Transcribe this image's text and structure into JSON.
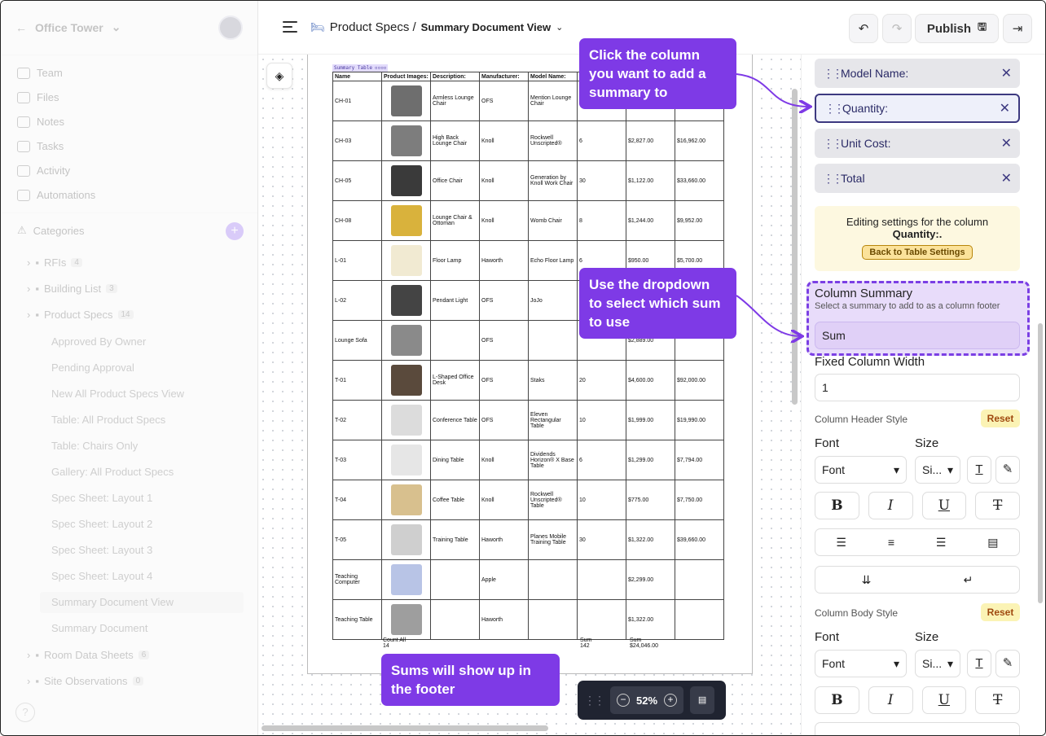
{
  "sidebar": {
    "workspace": "Office Tower",
    "nav": [
      {
        "label": "Team",
        "icon": "people-icon"
      },
      {
        "label": "Files",
        "icon": "file-icon"
      },
      {
        "label": "Notes",
        "icon": "note-icon"
      },
      {
        "label": "Tasks",
        "icon": "task-icon"
      },
      {
        "label": "Activity",
        "icon": "activity-icon"
      },
      {
        "label": "Automations",
        "icon": "bolt-icon"
      }
    ],
    "categories_label": "Categories",
    "tree": [
      {
        "label": "RFIs",
        "count": "4"
      },
      {
        "label": "Building List",
        "count": "3"
      },
      {
        "label": "Product Specs",
        "count": "14"
      }
    ],
    "views": [
      "Approved By Owner",
      "Pending Approval",
      "New All Product Specs View",
      "Table: All Product Specs",
      "Table: Chairs Only",
      "Gallery: All Product Specs",
      "Spec Sheet: Layout 1",
      "Spec Sheet: Layout 2",
      "Spec Sheet: Layout 3",
      "Spec Sheet: Layout 4",
      "Summary Document View",
      "Summary Document"
    ],
    "tree2": [
      {
        "label": "Room Data Sheets",
        "count": "6"
      },
      {
        "label": "Site Observations",
        "count": "0"
      }
    ],
    "help": "?"
  },
  "topbar": {
    "crumb1": "Product Specs /",
    "crumb2": "Summary Document View",
    "publish": "Publish"
  },
  "document": {
    "tag": "Summary Table",
    "headers": [
      "Name",
      "Product Images:",
      "Description:",
      "Manufacturer:",
      "Model Name:",
      "",
      "",
      ""
    ],
    "rows": [
      {
        "name": "CH-01",
        "desc": "Armless Lounge Chair",
        "mfr": "OFS",
        "model": "Mention Lounge Chair",
        "qty": "",
        "cost": "",
        "total": "",
        "color": "#6e6e6e"
      },
      {
        "name": "CH-03",
        "desc": "High Back Lounge Chair",
        "mfr": "Knoll",
        "model": "Rockwell Unscripted®",
        "qty": "6",
        "cost": "$2,827.00",
        "total": "$16,962.00",
        "color": "#7d7d7d"
      },
      {
        "name": "CH-05",
        "desc": "Office Chair",
        "mfr": "Knoll",
        "model": "Generation by Knoll Work Chair",
        "qty": "30",
        "cost": "$1,122.00",
        "total": "$33,660.00",
        "color": "#3a3a3a"
      },
      {
        "name": "CH-08",
        "desc": "Lounge Chair & Ottoman",
        "mfr": "Knoll",
        "model": "Womb Chair",
        "qty": "8",
        "cost": "$1,244.00",
        "total": "$9,952.00",
        "color": "#d9b23c"
      },
      {
        "name": "L-01",
        "desc": "Floor Lamp",
        "mfr": "Haworth",
        "model": "Echo Floor Lamp",
        "qty": "6",
        "cost": "$950.00",
        "total": "$5,700.00",
        "color": "#f1ead2"
      },
      {
        "name": "L-02",
        "desc": "Pendant Light",
        "mfr": "OFS",
        "model": "JoJo",
        "qty": "",
        "cost": "",
        "total": "",
        "color": "#444444"
      },
      {
        "name": "Lounge Sofa",
        "desc": "",
        "mfr": "OFS",
        "model": "",
        "qty": "",
        "cost": "$2,889.00",
        "total": "",
        "color": "#8a8a8a"
      },
      {
        "name": "T-01",
        "desc": "L-Shaped Office Desk",
        "mfr": "OFS",
        "model": "Staks",
        "qty": "20",
        "cost": "$4,600.00",
        "total": "$92,000.00",
        "color": "#5a4a3c"
      },
      {
        "name": "T-02",
        "desc": "Conference Table",
        "mfr": "OFS",
        "model": "Eleven Rectangular Table",
        "qty": "10",
        "cost": "$1,999.00",
        "total": "$19,990.00",
        "color": "#dcdcdc"
      },
      {
        "name": "T-03",
        "desc": "Dining Table",
        "mfr": "Knoll",
        "model": "Dividends Horizon® X Base Table",
        "qty": "6",
        "cost": "$1,299.00",
        "total": "$7,794.00",
        "color": "#e6e6e6"
      },
      {
        "name": "T-04",
        "desc": "Coffee Table",
        "mfr": "Knoll",
        "model": "Rockwell Unscripted® Table",
        "qty": "10",
        "cost": "$775.00",
        "total": "$7,750.00",
        "color": "#d8c08e"
      },
      {
        "name": "T-05",
        "desc": "Training Table",
        "mfr": "Haworth",
        "model": "Planes Mobile Training Table",
        "qty": "30",
        "cost": "$1,322.00",
        "total": "$39,660.00",
        "color": "#cfcfcf"
      },
      {
        "name": "Teaching Computer",
        "desc": "",
        "mfr": "Apple",
        "model": "",
        "qty": "",
        "cost": "$2,299.00",
        "total": "",
        "color": "#b8c4e6"
      },
      {
        "name": "Teaching Table",
        "desc": "",
        "mfr": "Haworth",
        "model": "",
        "qty": "",
        "cost": "$1,322.00",
        "total": "",
        "color": "#9e9e9e"
      }
    ],
    "footer": {
      "count": "Count All\n14",
      "sum_qty": "Sum\n142",
      "sum_cost": "Sum\n$24,046.00"
    }
  },
  "zoom": "52%",
  "panel": {
    "columns": [
      "Model Name:",
      "Quantity:",
      "Unit Cost:",
      "Total"
    ],
    "editing_text": "Editing settings for the column",
    "editing_col": "Quantity:.",
    "back_btn": "Back to Table Settings",
    "summary_label": "Column Summary",
    "summary_hint": "Select a summary to add to as a column footer",
    "summary_value": "Sum",
    "width_label": "Fixed Column Width",
    "width_value": "1",
    "header_style": "Column Header Style",
    "body_style": "Column Body Style",
    "reset": "Reset",
    "font_label": "Font",
    "size_label": "Size",
    "font_value": "Font",
    "size_value": "Si..."
  },
  "callouts": {
    "c1": "Click the column you want to add a summary to",
    "c2": "Use the dropdown to select which sum to use",
    "c3": "Sums will show up in the footer"
  },
  "colors": {
    "accent": "#7e3ae6",
    "selected_border": "#3d3980",
    "reset_bg": "#fbf3b5"
  }
}
